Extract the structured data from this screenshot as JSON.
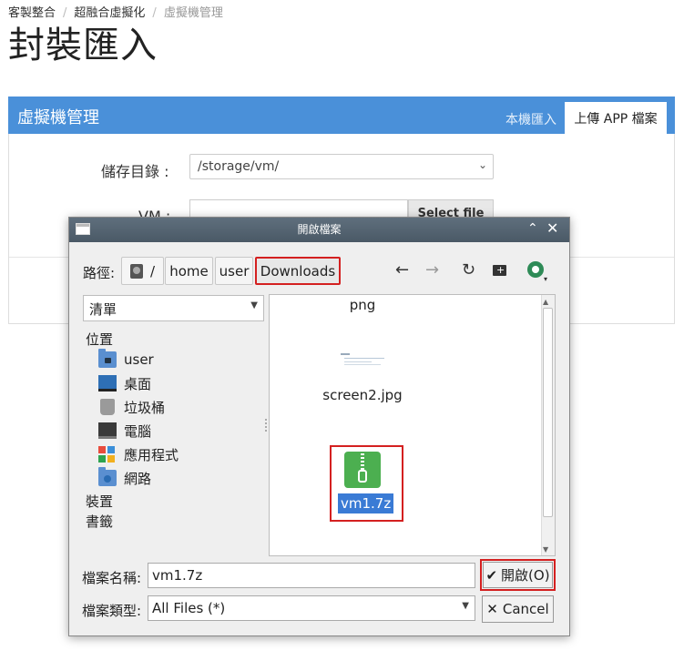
{
  "breadcrumb": [
    "客製整合",
    "超融合虛擬化",
    "虛擬機管理"
  ],
  "page_title": "封裝匯入",
  "panel": {
    "title": "虛擬機管理",
    "tabs": [
      "本機匯入",
      "上傳 APP 檔案"
    ],
    "storage_label": "儲存目錄 :",
    "storage_value": "/storage/vm/",
    "vm_label": "VM :",
    "select_file_label": "Select file"
  },
  "dialog": {
    "title": "開啟檔案",
    "path_label": "路徑:",
    "path_crumbs": [
      "/",
      "home",
      "user",
      "Downloads"
    ],
    "view_mode": "清單",
    "places_heading": "位置",
    "places": [
      "user",
      "桌面",
      "垃圾桶",
      "電腦",
      "應用程式",
      "網路"
    ],
    "devices_heading": "裝置",
    "bookmarks_heading": "書籤",
    "files": [
      "png",
      "screen2.jpg",
      "vm1.7z"
    ],
    "filename_label": "檔案名稱:",
    "filename_value": "vm1.7z",
    "filetype_label": "檔案類型:",
    "filetype_value": "All Files (*)",
    "open_label": "開啟(O)",
    "cancel_label": "Cancel"
  },
  "colors": {
    "panel_header": "#4a90d9",
    "selection": "#3a7bd5",
    "highlight_border": "#d42020"
  }
}
